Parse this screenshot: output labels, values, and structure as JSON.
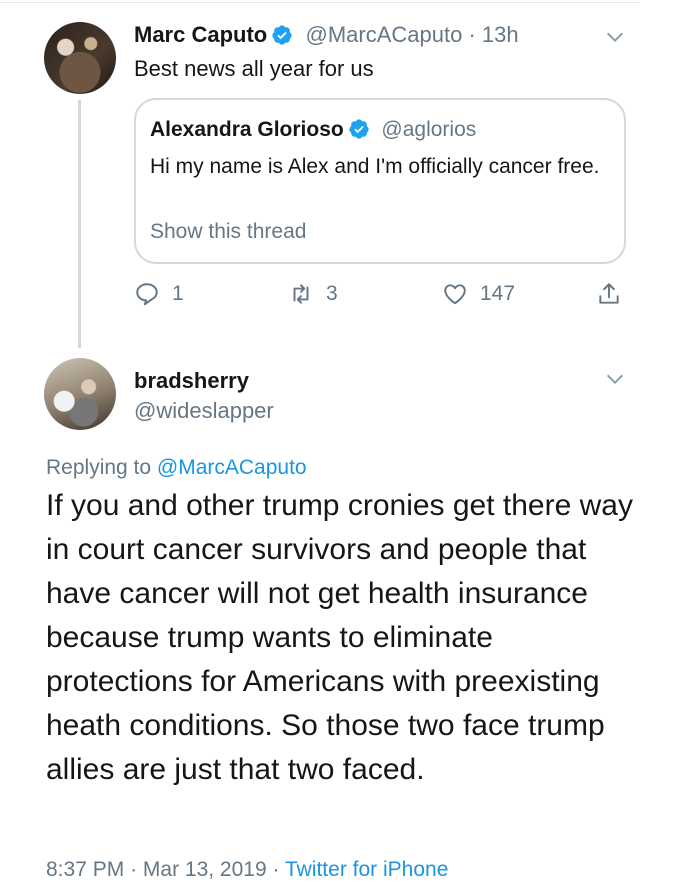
{
  "tweet": {
    "author_name": "Marc Caputo",
    "author_handle": "@MarcACaputo",
    "separator": "·",
    "time_ago": "13h",
    "text": "Best news all year for us",
    "verified": true
  },
  "quoted_tweet": {
    "author_name": "Alexandra Glorioso",
    "author_handle": "@aglorios",
    "verified": true,
    "text": "Hi my name is Alex and I'm officially cancer free.",
    "show_thread_label": "Show this thread"
  },
  "actions": {
    "reply_count": "1",
    "retweet_count": "3",
    "like_count": "147"
  },
  "reply": {
    "author_name": "bradsherry",
    "author_handle": "@wideslapper",
    "replying_to_label": "Replying to",
    "replying_to_handle": "@MarcACaputo",
    "text": "If you and other trump cronies get there way in court cancer survivors and people that have cancer will not get health insurance because trump wants to eliminate protections for Americans with preexisting heath conditions. So those two face trump allies are just that two faced.",
    "time": "8:37 PM",
    "date": "Mar 13, 2019",
    "separator": "·",
    "source": "Twitter for iPhone"
  },
  "colors": {
    "link": "#1b95e0",
    "muted": "#657786",
    "verified": "#1da1f2",
    "border": "#cfd9de"
  },
  "icons": [
    "verified-badge-icon",
    "chevron-down-icon",
    "reply-icon",
    "retweet-icon",
    "like-icon",
    "share-icon"
  ]
}
